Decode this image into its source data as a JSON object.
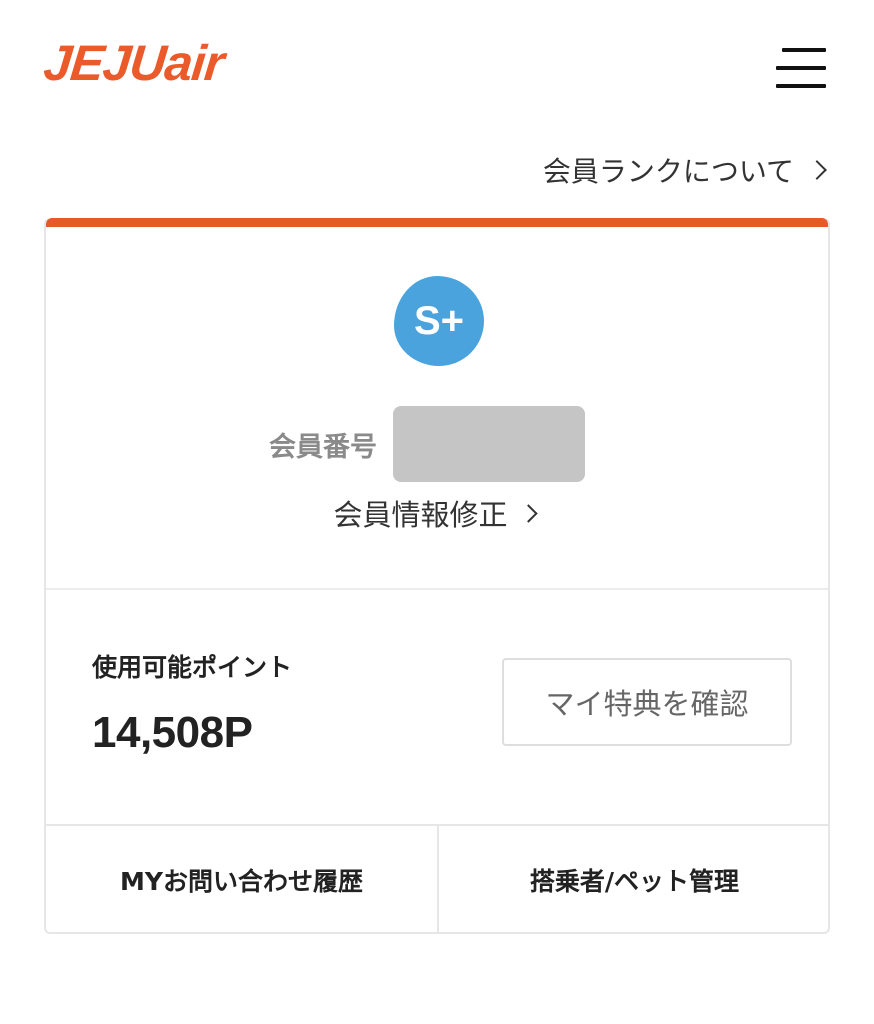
{
  "header": {
    "logo_text": "JEJUair",
    "brand_color": "#e8592a",
    "menu_icon": "hamburger-menu-icon"
  },
  "rank_link": {
    "label": "会員ランクについて"
  },
  "card": {
    "rank_badge": "S+",
    "rank_badge_color": "#4aa3dd",
    "member_number_label": "会員番号",
    "member_number_value": "",
    "edit_link": "会員情報修正",
    "points_label": "使用可能ポイント",
    "points_value": "14,508P",
    "benefit_button": "マイ特典を確認",
    "bottom_left_button": "MYお問い合わせ履歴",
    "bottom_right_button": "搭乗者/ペット管理"
  }
}
